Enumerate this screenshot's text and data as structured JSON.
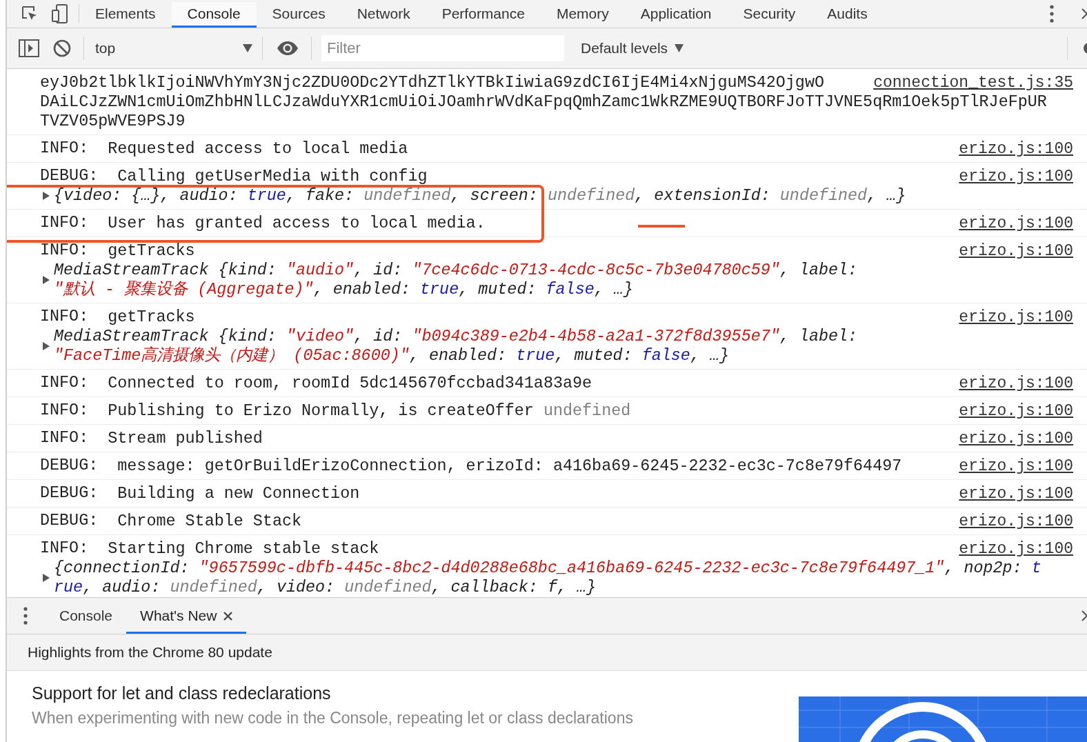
{
  "tabs": [
    {
      "label": "Elements",
      "selected": false
    },
    {
      "label": "Console",
      "selected": true
    },
    {
      "label": "Sources",
      "selected": false
    },
    {
      "label": "Network",
      "selected": false
    },
    {
      "label": "Performance",
      "selected": false
    },
    {
      "label": "Memory",
      "selected": false
    },
    {
      "label": "Application",
      "selected": false
    },
    {
      "label": "Security",
      "selected": false
    },
    {
      "label": "Audits",
      "selected": false
    }
  ],
  "toolbar": {
    "context": "top",
    "filter_placeholder": "Filter",
    "levels": "Default levels"
  },
  "messages": [
    {
      "source": "connection_test.js:35",
      "lines": [
        [
          {
            "text": "eyJ0b2tlbklkIjoiNWVhYmY3Njc2ZDU0ODc2YTdhZTlkYTBkIiwiaG9zdCI6IjE4Mi4xNjguMS42OjgwO",
            "kind": "plain"
          }
        ],
        [
          {
            "text": "DAiLCJzZWN1cmUiOmZhbHNlLCJzaWduYXR1cmUiOiJOamhrWVdKaFpqQmhZamc1WkRZME9UQTBORFJoTTJVNE5qRm1Oek5pTlRJeFpUR",
            "kind": "plain"
          }
        ],
        [
          {
            "text": "TVZV05pWVE9PSJ9",
            "kind": "plain"
          }
        ]
      ]
    },
    {
      "level": "INFO:",
      "source": "erizo.js:100",
      "lines": [
        [
          {
            "text": "Requested access to local media",
            "kind": "plain"
          }
        ]
      ]
    },
    {
      "level": "DEBUG:",
      "source": "erizo.js:100",
      "lines": [
        [
          {
            "text": "Calling getUserMedia with config",
            "kind": "plain"
          }
        ]
      ],
      "preview": {
        "expanded": false,
        "lines": [
          [
            {
              "text": "{video: {…}, audio: ",
              "kind": "key"
            },
            {
              "text": "true",
              "kind": "bool"
            },
            {
              "text": ", fake: ",
              "kind": "key"
            },
            {
              "text": "undefined",
              "kind": "undef"
            },
            {
              "text": ", screen: ",
              "kind": "key"
            },
            {
              "text": "undefined",
              "kind": "undef"
            },
            {
              "text": ", extensionId: ",
              "kind": "key"
            },
            {
              "text": "undefined",
              "kind": "undef"
            },
            {
              "text": ", …}",
              "kind": "key"
            }
          ]
        ]
      }
    },
    {
      "level": "INFO:",
      "source": "erizo.js:100",
      "lines": [
        [
          {
            "text": "User has granted access to local media.",
            "kind": "plain"
          }
        ]
      ]
    },
    {
      "level": "INFO:",
      "source": "erizo.js:100",
      "lines": [
        [
          {
            "text": "getTracks",
            "kind": "plain"
          }
        ]
      ],
      "preview": {
        "expanded": false,
        "lines": [
          [
            {
              "text": "MediaStreamTrack {kind: ",
              "kind": "key"
            },
            {
              "text": "\"audio\"",
              "kind": "string"
            },
            {
              "text": ", id: ",
              "kind": "key"
            },
            {
              "text": "\"7ce4c6dc-0713-4cdc-8c5c-7b3e04780c59\"",
              "kind": "string"
            },
            {
              "text": ", label:",
              "kind": "key"
            }
          ],
          [
            {
              "text": "\"默认 - 聚集设备 (Aggregate)\"",
              "kind": "string"
            },
            {
              "text": ", enabled: ",
              "kind": "key"
            },
            {
              "text": "true",
              "kind": "bool"
            },
            {
              "text": ", muted: ",
              "kind": "key"
            },
            {
              "text": "false",
              "kind": "bool"
            },
            {
              "text": ", …}",
              "kind": "key"
            }
          ]
        ]
      }
    },
    {
      "level": "INFO:",
      "source": "erizo.js:100",
      "lines": [
        [
          {
            "text": "getTracks",
            "kind": "plain"
          }
        ]
      ],
      "preview": {
        "expanded": false,
        "lines": [
          [
            {
              "text": "MediaStreamTrack {kind: ",
              "kind": "key"
            },
            {
              "text": "\"video\"",
              "kind": "string"
            },
            {
              "text": ", id: ",
              "kind": "key"
            },
            {
              "text": "\"b094c389-e2b4-4b58-a2a1-372f8d3955e7\"",
              "kind": "string"
            },
            {
              "text": ", label:",
              "kind": "key"
            }
          ],
          [
            {
              "text": "\"FaceTime高清摄像头（内建） (05ac:8600)\"",
              "kind": "string"
            },
            {
              "text": ", enabled: ",
              "kind": "key"
            },
            {
              "text": "true",
              "kind": "bool"
            },
            {
              "text": ", muted: ",
              "kind": "key"
            },
            {
              "text": "false",
              "kind": "bool"
            },
            {
              "text": ", …}",
              "kind": "key"
            }
          ]
        ]
      }
    },
    {
      "level": "INFO:",
      "source": "erizo.js:100",
      "lines": [
        [
          {
            "text": "Connected to room, roomId 5dc145670fccbad341a83a9e",
            "kind": "plain"
          }
        ]
      ]
    },
    {
      "level": "INFO:",
      "source": "erizo.js:100",
      "lines": [
        [
          {
            "text": "Publishing to Erizo Normally, is createOffer ",
            "kind": "plain"
          },
          {
            "text": "undefined",
            "kind": "undef"
          }
        ]
      ]
    },
    {
      "level": "INFO:",
      "source": "erizo.js:100",
      "lines": [
        [
          {
            "text": "Stream published",
            "kind": "plain"
          }
        ]
      ]
    },
    {
      "level": "DEBUG:",
      "source": "erizo.js:100",
      "lines": [
        [
          {
            "text": "message: getOrBuildErizoConnection, erizoId: a416ba69-6245-2232-ec3c-7c8e79f64497",
            "kind": "plain"
          }
        ]
      ]
    },
    {
      "level": "DEBUG:",
      "source": "erizo.js:100",
      "lines": [
        [
          {
            "text": "Building a new Connection",
            "kind": "plain"
          }
        ]
      ]
    },
    {
      "level": "DEBUG:",
      "source": "erizo.js:100",
      "lines": [
        [
          {
            "text": "Chrome Stable Stack",
            "kind": "plain"
          }
        ]
      ]
    },
    {
      "level": "INFO:",
      "source": "erizo.js:100",
      "lines": [
        [
          {
            "text": "Starting Chrome stable stack",
            "kind": "plain"
          }
        ]
      ],
      "preview": {
        "expanded": false,
        "lines": [
          [
            {
              "text": "{connectionId: ",
              "kind": "key"
            },
            {
              "text": "\"9657599c-dbfb-445c-8bc2-d4d0288e68bc_a416ba69-6245-2232-ec3c-7c8e79f64497_1\"",
              "kind": "string"
            },
            {
              "text": ", nop2p: ",
              "kind": "key"
            },
            {
              "text": "t",
              "kind": "bool"
            }
          ],
          [
            {
              "text": "rue",
              "kind": "bool"
            },
            {
              "text": ", audio: ",
              "kind": "key"
            },
            {
              "text": "undefined",
              "kind": "undef"
            },
            {
              "text": ", video: ",
              "kind": "key"
            },
            {
              "text": "undefined",
              "kind": "undef"
            },
            {
              "text": ", callback: f, …}",
              "kind": "key"
            }
          ]
        ]
      }
    }
  ],
  "drawer": {
    "tabs": [
      {
        "label": "Console",
        "selected": false,
        "closable": false
      },
      {
        "label": "What's New",
        "selected": true,
        "closable": true
      }
    ],
    "header": "Highlights from the Chrome 80 update",
    "article": {
      "title": "Support for let and class redeclarations",
      "description": "When experimenting with new code in the Console, repeating let or class declarations"
    }
  }
}
